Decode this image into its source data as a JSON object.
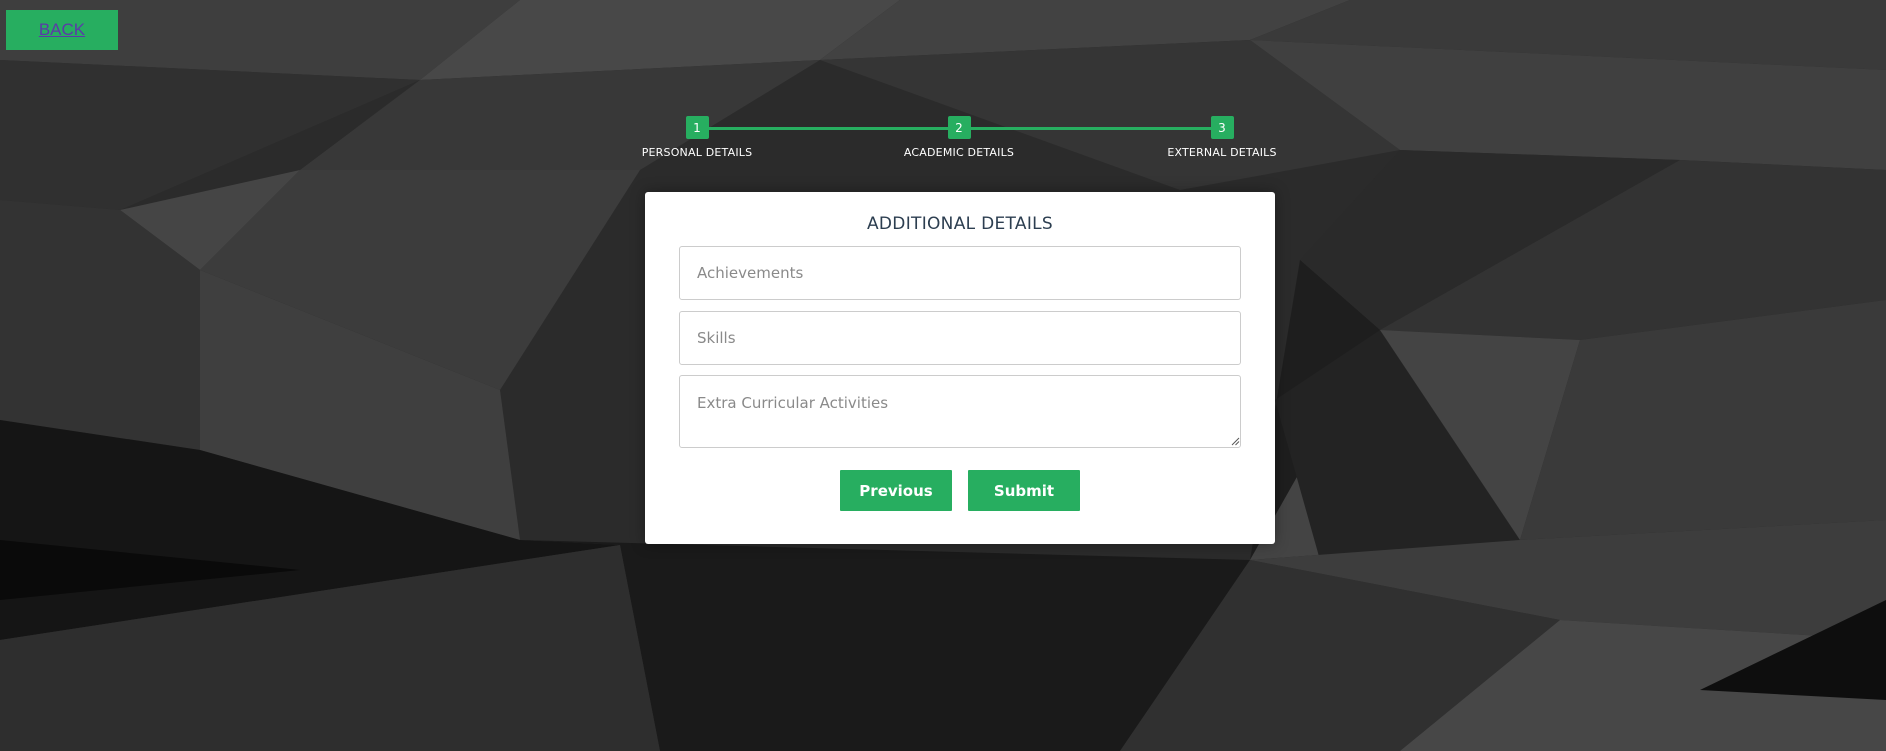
{
  "colors": {
    "accent": "#27ae60",
    "back_text": "#5b3aa8",
    "title_text": "#2c3e50",
    "card_bg": "#ffffff",
    "field_border": "#cccccc"
  },
  "back": {
    "label": "BACK"
  },
  "progress": {
    "steps": [
      {
        "number": "1",
        "label": "PERSONAL DETAILS"
      },
      {
        "number": "2",
        "label": "ACADEMIC DETAILS"
      },
      {
        "number": "3",
        "label": "EXTERNAL DETAILS"
      }
    ]
  },
  "form": {
    "title": "ADDITIONAL DETAILS",
    "achievements": {
      "placeholder": "Achievements",
      "value": ""
    },
    "skills": {
      "placeholder": "Skills",
      "value": ""
    },
    "extra_curricular": {
      "placeholder": "Extra Curricular Activities",
      "value": ""
    },
    "previous_label": "Previous",
    "submit_label": "Submit"
  },
  "icons": {
    "resize_handle": "resize-grip-icon"
  }
}
